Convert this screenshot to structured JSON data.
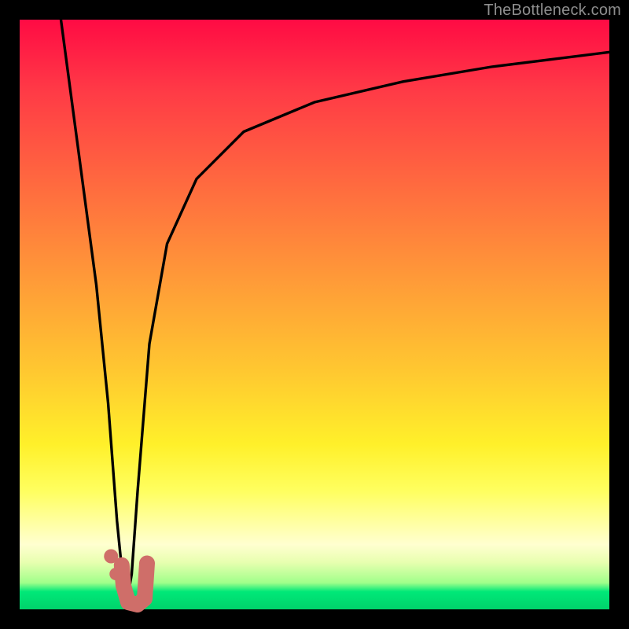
{
  "watermark": "TheBottleneck.com",
  "chart_data": {
    "type": "line",
    "title": "",
    "xlabel": "",
    "ylabel": "",
    "xlim": [
      0,
      100
    ],
    "ylim": [
      0,
      100
    ],
    "grid": false,
    "series": [
      {
        "name": "bottleneck-curve-left",
        "x": [
          7,
          9,
          11,
          13,
          15,
          16.5,
          18
        ],
        "values": [
          100,
          85,
          70,
          55,
          35,
          15,
          0
        ]
      },
      {
        "name": "bottleneck-curve-right",
        "x": [
          18,
          19,
          20,
          22,
          25,
          30,
          38,
          50,
          65,
          80,
          92,
          100
        ],
        "values": [
          0,
          6,
          20,
          45,
          62,
          73,
          81,
          86,
          89.5,
          92,
          93.5,
          94.5
        ]
      }
    ],
    "highlight": {
      "color": "#cf6e69",
      "dots": [
        {
          "x": 15.5,
          "y": 9
        },
        {
          "x": 16.3,
          "y": 6
        }
      ],
      "hook": {
        "points": [
          {
            "x": 17.3,
            "y": 7.5
          },
          {
            "x": 17.6,
            "y": 4.0
          },
          {
            "x": 18.4,
            "y": 1.2
          },
          {
            "x": 20.0,
            "y": 0.8
          },
          {
            "x": 21.2,
            "y": 1.8
          },
          {
            "x": 21.6,
            "y": 7.8
          }
        ]
      }
    },
    "colors": {
      "curve": "#000000",
      "highlight": "#cf6e69"
    }
  }
}
